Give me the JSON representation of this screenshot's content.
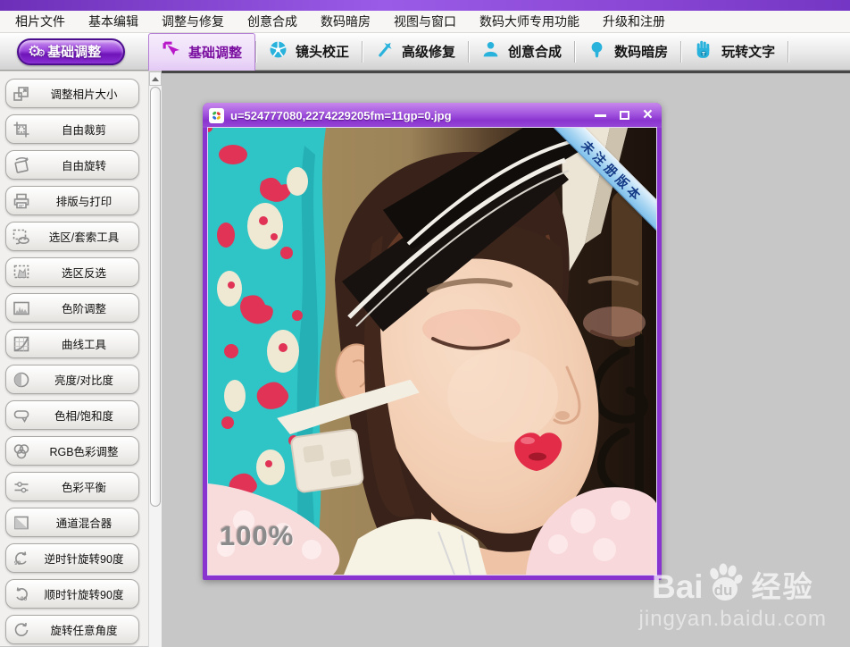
{
  "menu_bar": {
    "items": [
      "相片文件",
      "基本编辑",
      "调整与修复",
      "创意合成",
      "数码暗房",
      "视图与窗口",
      "数码大师专用功能",
      "升级和注册"
    ]
  },
  "toolbar": {
    "mode_button_label": "基础调整",
    "tabs": [
      {
        "label": "基础调整",
        "icon": "cursor-select-icon",
        "active": true
      },
      {
        "label": "镜头校正",
        "icon": "aperture-icon",
        "active": false
      },
      {
        "label": "高级修复",
        "icon": "magic-wand-icon",
        "active": false
      },
      {
        "label": "创意合成",
        "icon": "person-icon",
        "active": false
      },
      {
        "label": "数码暗房",
        "icon": "lightbulb-icon",
        "active": false
      },
      {
        "label": "玩转文字",
        "icon": "hand-icon",
        "active": false
      }
    ]
  },
  "sidebar": {
    "items": [
      {
        "label": "调整相片大小",
        "icon": "resize-icon"
      },
      {
        "label": "自由裁剪",
        "icon": "crop-icon"
      },
      {
        "label": "自由旋转",
        "icon": "free-rotate-icon"
      },
      {
        "label": "排版与打印",
        "icon": "print-icon"
      },
      {
        "label": "选区/套索工具",
        "icon": "lasso-icon"
      },
      {
        "label": "选区反选",
        "icon": "invert-selection-icon"
      },
      {
        "label": "色阶调整",
        "icon": "levels-icon"
      },
      {
        "label": "曲线工具",
        "icon": "curves-icon"
      },
      {
        "label": "亮度/对比度",
        "icon": "brightness-contrast-icon"
      },
      {
        "label": "色相/饱和度",
        "icon": "hue-saturation-icon"
      },
      {
        "label": "RGB色彩调整",
        "icon": "rgb-circles-icon"
      },
      {
        "label": "色彩平衡",
        "icon": "color-balance-icon"
      },
      {
        "label": "通道混合器",
        "icon": "channel-mixer-icon"
      },
      {
        "label": "逆时针旋转90度",
        "icon": "rotate-ccw-90-icon"
      },
      {
        "label": "顺时针旋转90度",
        "icon": "rotate-cw-90-icon"
      },
      {
        "label": "旋转任意角度",
        "icon": "rotate-any-angle-icon"
      }
    ]
  },
  "photo_window": {
    "title": "u=524777080,2274229205fm=11gp=0.jpg",
    "unregistered_banner": "未注册版本",
    "zoom_label": "100%"
  },
  "watermark": {
    "brand_latin": "Bai",
    "brand_du": "du",
    "brand_cn": "经验",
    "url": "jingyan.baidu.com"
  },
  "colors": {
    "accent_purple": "#8a34cf",
    "toolbar_icon_blue": "#28b2dc",
    "active_tab_text": "#7a0fa0",
    "banner_blue": "#7fc0ec",
    "canvas_gray": "#c7c7c7"
  }
}
